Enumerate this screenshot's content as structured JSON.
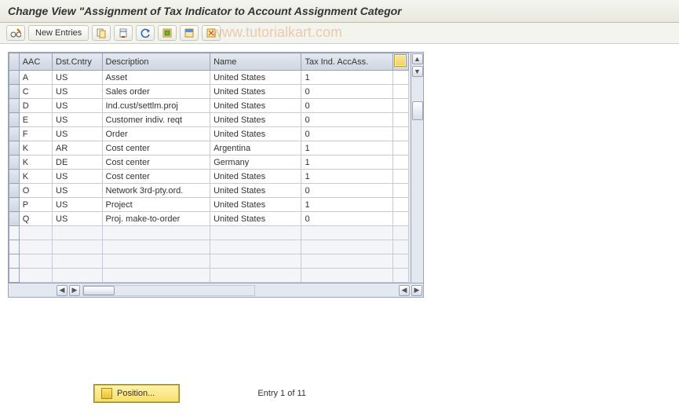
{
  "title": "Change View \"Assignment of Tax Indicator to Account Assignment Categor",
  "toolbar": {
    "new_entries": "New Entries"
  },
  "watermark": "www.tutorialkart.com",
  "columns": {
    "aac": "AAC",
    "cntry": "Dst.Cntry",
    "desc": "Description",
    "name": "Name",
    "tax": "Tax Ind. AccAss."
  },
  "rows": [
    {
      "aac": "A",
      "cntry": "US",
      "desc": "Asset",
      "name": "United States",
      "tax": "1"
    },
    {
      "aac": "C",
      "cntry": "US",
      "desc": "Sales order",
      "name": "United States",
      "tax": "0"
    },
    {
      "aac": "D",
      "cntry": "US",
      "desc": "Ind.cust/settlm.proj",
      "name": "United States",
      "tax": "0"
    },
    {
      "aac": "E",
      "cntry": "US",
      "desc": "Customer indiv. reqt",
      "name": "United States",
      "tax": "0"
    },
    {
      "aac": "F",
      "cntry": "US",
      "desc": "Order",
      "name": "United States",
      "tax": "0"
    },
    {
      "aac": "K",
      "cntry": "AR",
      "desc": "Cost center",
      "name": "Argentina",
      "tax": "1"
    },
    {
      "aac": "K",
      "cntry": "DE",
      "desc": "Cost center",
      "name": "Germany",
      "tax": "1"
    },
    {
      "aac": "K",
      "cntry": "US",
      "desc": "Cost center",
      "name": "United States",
      "tax": "1"
    },
    {
      "aac": "O",
      "cntry": "US",
      "desc": "Network 3rd-pty.ord.",
      "name": "United States",
      "tax": "0"
    },
    {
      "aac": "P",
      "cntry": "US",
      "desc": "Project",
      "name": "United States",
      "tax": "1"
    },
    {
      "aac": "Q",
      "cntry": "US",
      "desc": "Proj. make-to-order",
      "name": "United States",
      "tax": "0"
    }
  ],
  "footer": {
    "position_label": "Position...",
    "entry_text": "Entry 1 of 11"
  }
}
